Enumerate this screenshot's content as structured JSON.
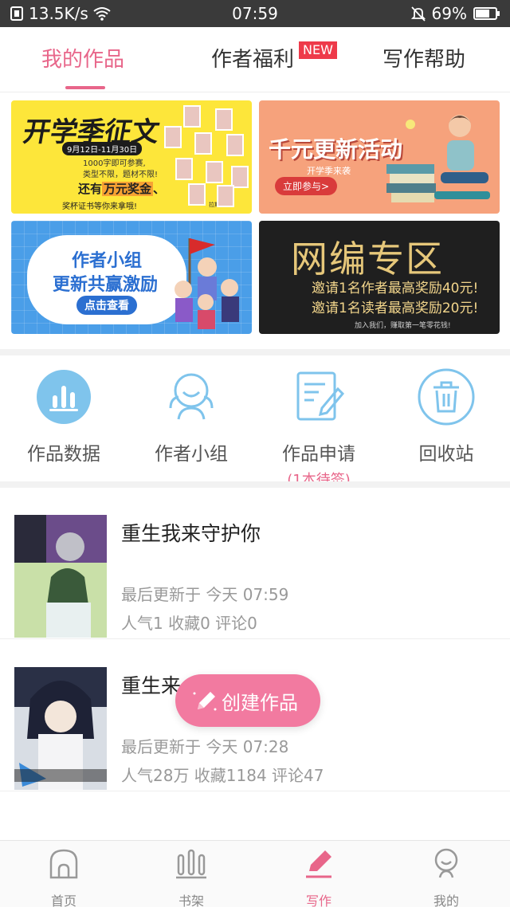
{
  "status_bar": {
    "net_speed": "13.5K/s",
    "time": "07:59",
    "battery": "69%",
    "icons": [
      "screenshot-icon",
      "wifi-icon",
      "mute-bell-icon",
      "battery-icon"
    ]
  },
  "tabs": {
    "items": [
      {
        "label": "我的作品",
        "active": true
      },
      {
        "label": "作者福利",
        "active": false,
        "badge": "NEW"
      },
      {
        "label": "写作帮助",
        "active": false
      }
    ],
    "accent_color": "#e8668a"
  },
  "banners": {
    "b1": {
      "title": "开学季征文",
      "date": "9月12日-11月30日",
      "line1": "1000字即可参赛,",
      "line2": "类型不限，题材不限!",
      "prize_prefix": "还有",
      "prize_highlight": "万元奖金",
      "prize_suffix": "、",
      "bottom": "奖杯证书等你来拿哦!",
      "sign": "拉斯网文"
    },
    "b2": {
      "title": "千元更新活动",
      "subtitle": "开学季来袭",
      "button": "立即参与>"
    },
    "b3": {
      "title1": "作者小组",
      "title2": "更新共赢激励",
      "button": "点击查看"
    },
    "b4": {
      "title": "网编专区",
      "line1": "邀请1名作者最高奖励40元!",
      "line2": "邀请1名读者最高奖励20元!",
      "small": "加入我们，赚取第一笔零花钱!"
    }
  },
  "actions": [
    {
      "label": "作品数据",
      "icon": "bar-chart-icon"
    },
    {
      "label": "作者小组",
      "icon": "group-icon"
    },
    {
      "label": "作品申请",
      "icon": "edit-document-icon",
      "sub": "(1本待签)"
    },
    {
      "label": "回收站",
      "icon": "trash-icon"
    }
  ],
  "works": [
    {
      "title": "重生我来守护你",
      "updated": "最后更新于 今天 07:59",
      "stats": "人气1 收藏0 评论0"
    },
    {
      "title": "重生来",
      "updated": "最后更新于 今天 07:28",
      "stats": "人气28万 收藏1184 评论47"
    }
  ],
  "fab": {
    "label": "创建作品",
    "icon": "pencil-icon",
    "color": "#f27aa0"
  },
  "bottom_nav": [
    {
      "label": "首页",
      "icon": "home-icon",
      "active": false
    },
    {
      "label": "书架",
      "icon": "bookshelf-icon",
      "active": false
    },
    {
      "label": "写作",
      "icon": "pen-icon",
      "active": true
    },
    {
      "label": "我的",
      "icon": "profile-icon",
      "active": false
    }
  ]
}
